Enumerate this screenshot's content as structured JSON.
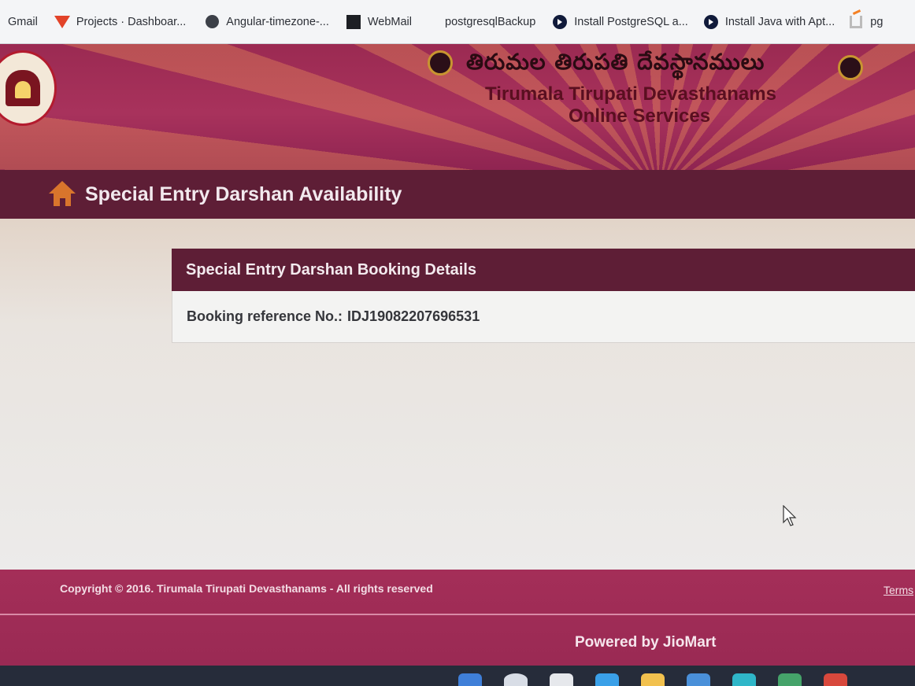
{
  "bookmarks": [
    {
      "label": "Gmail",
      "icon": "gmail-icon"
    },
    {
      "label": "Projects · Dashboar...",
      "icon": "gitlab-icon"
    },
    {
      "label": "Angular-timezone-...",
      "icon": "globe-icon"
    },
    {
      "label": "WebMail",
      "icon": "webmail-icon"
    },
    {
      "label": "postgresqlBackup",
      "icon": "blank-icon"
    },
    {
      "label": "Install PostgreSQL a...",
      "icon": "play-icon"
    },
    {
      "label": "Install Java with Apt...",
      "icon": "play-icon"
    },
    {
      "label": "pg",
      "icon": "stackoverflow-icon"
    }
  ],
  "header": {
    "telugu_title": "తిరుమల తిరుపతి దేవస్థానములు",
    "org_name": "Tirumala Tirupati Devasthanams",
    "subtitle": "Online Services"
  },
  "titlebar": {
    "title": "Special Entry Darshan Availability"
  },
  "panel": {
    "heading": "Special Entry Darshan Booking Details",
    "ref_label": "Booking reference No.:",
    "ref_value": "IDJ19082207696531"
  },
  "footer": {
    "copyright": "Copyright © 2016. Tirumala Tirupati Devasthanams - All rights reserved",
    "terms": "Terms",
    "powered": "Powered by JioMart"
  },
  "colors": {
    "banner": "#a8325c",
    "titlebar": "#5e1e36",
    "home_icon": "#d9752c",
    "footer": "#a42e58"
  }
}
